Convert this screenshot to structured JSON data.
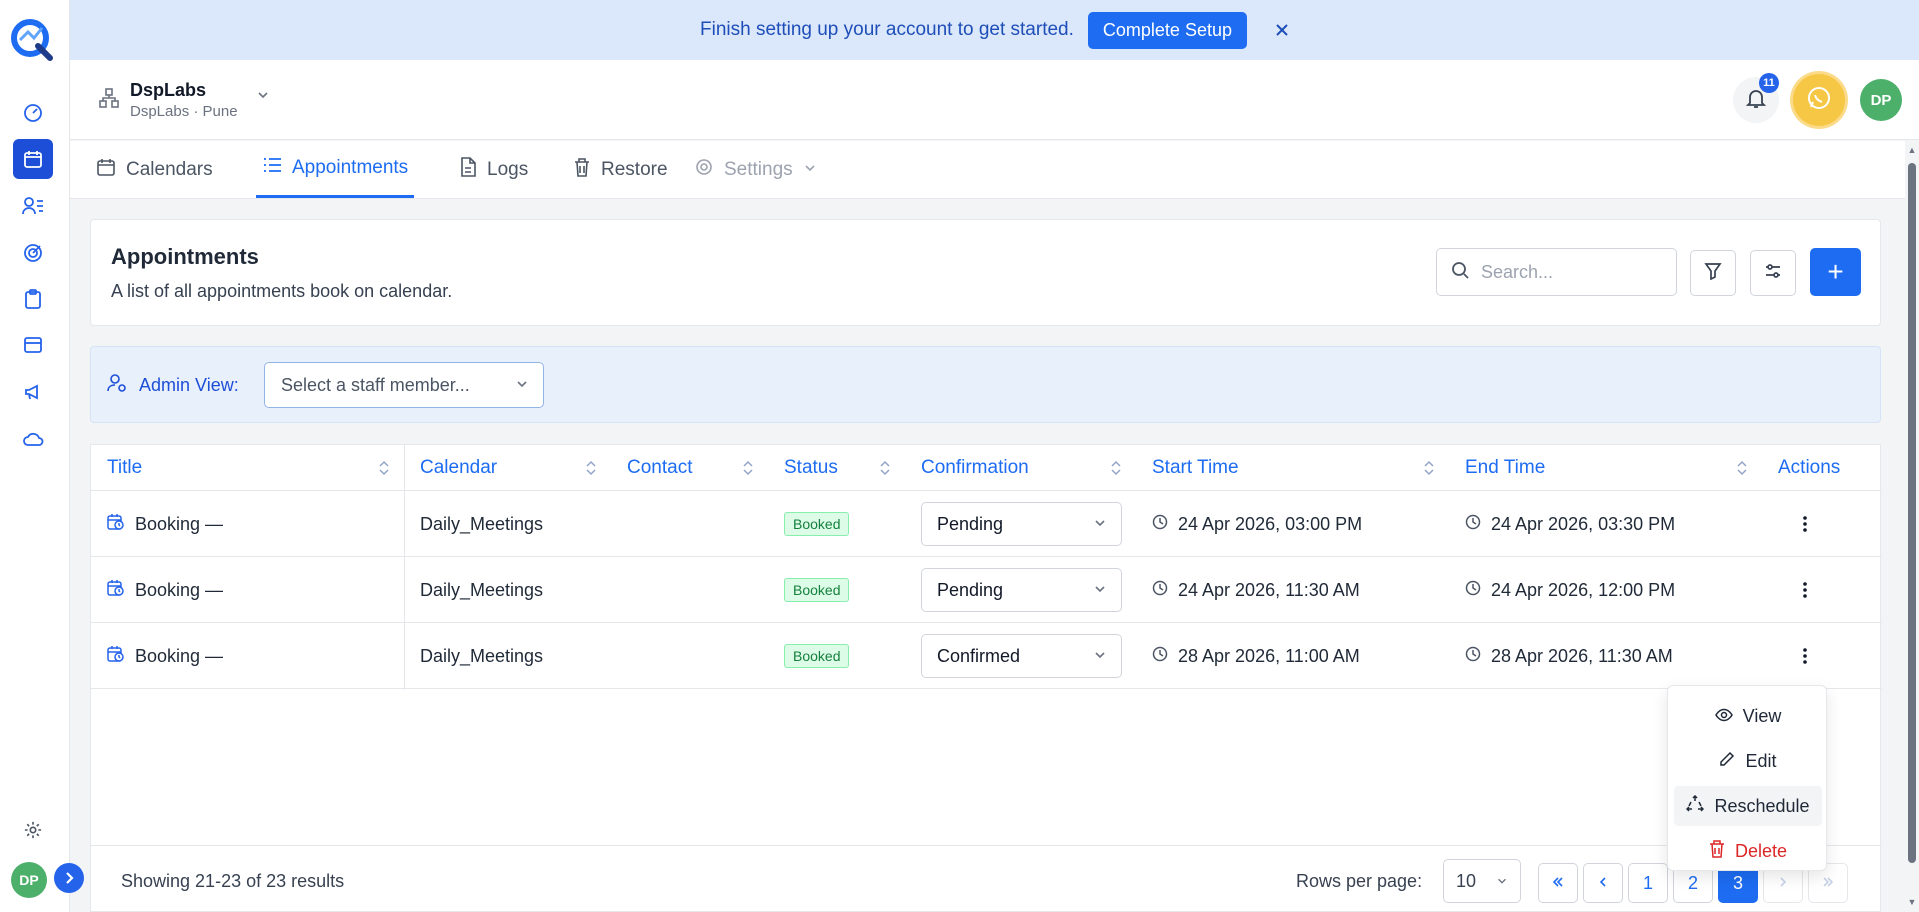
{
  "banner": {
    "text": "Finish setting up your account to get started.",
    "button": "Complete Setup"
  },
  "org": {
    "name": "DspLabs",
    "sub": "DspLabs · Pune"
  },
  "header": {
    "notification_count": "11",
    "avatar_initials": "DP"
  },
  "sidebar": {
    "avatar_initials": "DP"
  },
  "tabs": [
    {
      "label": "Calendars"
    },
    {
      "label": "Appointments"
    },
    {
      "label": "Logs"
    },
    {
      "label": "Restore"
    },
    {
      "label": "Settings"
    }
  ],
  "page": {
    "title": "Appointments",
    "subtitle": "A list of all appointments book on calendar.",
    "search_placeholder": "Search...",
    "add_label": "+"
  },
  "admin": {
    "label": "Admin View:",
    "select_placeholder": "Select a staff member..."
  },
  "table": {
    "headers": [
      "Title",
      "Calendar",
      "Contact",
      "Status",
      "Confirmation",
      "Start Time",
      "End Time",
      "Actions"
    ],
    "rows": [
      {
        "title": "Booking —",
        "calendar": "Daily_Meetings",
        "contact": "",
        "status": "Booked",
        "confirmation": "Pending",
        "start": "24 Apr 2026, 03:00 PM",
        "end": "24 Apr 2026, 03:30 PM"
      },
      {
        "title": "Booking —",
        "calendar": "Daily_Meetings",
        "contact": "",
        "status": "Booked",
        "confirmation": "Pending",
        "start": "24 Apr 2026, 11:30 AM",
        "end": "24 Apr 2026, 12:00 PM"
      },
      {
        "title": "Booking —",
        "calendar": "Daily_Meetings",
        "contact": "",
        "status": "Booked",
        "confirmation": "Confirmed",
        "start": "28 Apr 2026, 11:00 AM",
        "end": "28 Apr 2026, 11:30 AM"
      }
    ]
  },
  "menu": {
    "view": "View",
    "edit": "Edit",
    "reschedule": "Reschedule",
    "delete": "Delete"
  },
  "footer": {
    "showing": "Showing 21-23 of 23 results",
    "rows_per_page_label": "Rows per page:",
    "rows_per_page": "10",
    "pages": [
      "1",
      "2",
      "3"
    ],
    "current_page": "3"
  },
  "colors": {
    "accent": "#1d6cf2",
    "success_bg": "#dcfce7",
    "danger": "#dc2626",
    "avatar": "#4caf6a",
    "whatsapp_ring": "#f6c744"
  }
}
